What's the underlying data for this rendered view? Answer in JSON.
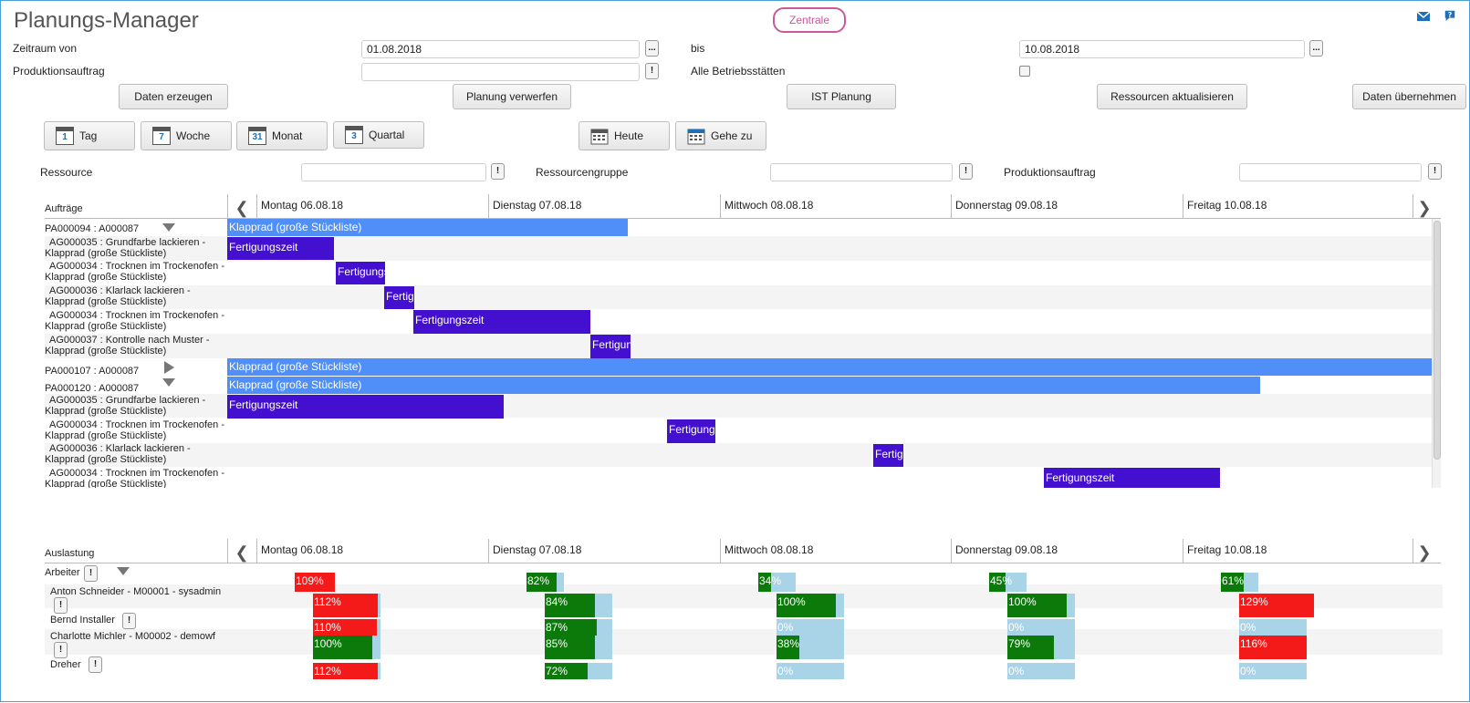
{
  "header": {
    "title": "Planungs-Manager",
    "badge": "Zentrale",
    "icons": [
      "mail-icon",
      "help-icon"
    ]
  },
  "filters": {
    "zeitraum_label": "Zeitraum von",
    "date_from": "01.08.2018",
    "bis_label": "bis",
    "date_to": "10.08.2018",
    "produktionsauftrag_label": "Produktionsauftrag",
    "produktionsauftrag_value": "",
    "alle_betriebsstaetten_label": "Alle Betriebsstätten",
    "browse_symbol": "...",
    "info_symbol": "!"
  },
  "actions": {
    "daten_erzeugen": "Daten erzeugen",
    "planung_verwerfen": "Planung verwerfen",
    "ist_planung": "IST Planung",
    "ressourcen_aktualisieren": "Ressourcen aktualisieren",
    "daten_uebernehmen": "Daten übernehmen"
  },
  "views": {
    "tag": "Tag",
    "tag_num": "1",
    "woche": "Woche",
    "woche_num": "7",
    "monat": "Monat",
    "monat_num": "31",
    "quartal": "Quartal",
    "quartal_num": "3",
    "heute": "Heute",
    "gehe_zu": "Gehe zu"
  },
  "search": {
    "ressource_label": "Ressource",
    "ressourcengruppe_label": "Ressourcengruppe",
    "produktionsauftrag_label": "Produktionsauftrag"
  },
  "gantt": {
    "header_label": "Aufträge",
    "days": [
      "Montag 06.08.18",
      "Dienstag 07.08.18",
      "Mittwoch 08.08.18",
      "Donnerstag 09.08.18",
      "Freitag 10.08.18"
    ],
    "rows": [
      {
        "label1": "PA000094 : A000087",
        "label2": "",
        "bar_text": "Klapprad (große Stückliste)"
      },
      {
        "label1": "AG000035 : Grundfarbe lackieren -",
        "label2": "Klapprad (große Stückliste)",
        "bar_text": "Fertigungszeit"
      },
      {
        "label1": "AG000034 : Trocknen im Trockenofen -",
        "label2": "Klapprad (große Stückliste)",
        "bar_text": "Fertigungszeit"
      },
      {
        "label1": "AG000036 : Klarlack lackieren -",
        "label2": "Klapprad (große Stückliste)",
        "bar_text": "Fertigungszeit"
      },
      {
        "label1": "AG000034 : Trocknen im Trockenofen -",
        "label2": "Klapprad (große Stückliste)",
        "bar_text": "Fertigungszeit"
      },
      {
        "label1": "AG000037 : Kontrolle nach Muster -",
        "label2": "Klapprad (große Stückliste)",
        "bar_text": "Fertigungszeit"
      },
      {
        "label1": "PA000107 : A000087",
        "label2": "",
        "bar_text": "Klapprad (große Stückliste)"
      },
      {
        "label1": "PA000120 : A000087",
        "label2": "",
        "bar_text": "Klapprad (große Stückliste)"
      },
      {
        "label1": "AG000035 : Grundfarbe lackieren -",
        "label2": "Klapprad (große Stückliste)",
        "bar_text": "Fertigungszeit"
      },
      {
        "label1": "AG000034 : Trocknen im Trockenofen -",
        "label2": "Klapprad (große Stückliste)",
        "bar_text": "Fertigungszeit"
      },
      {
        "label1": "AG000036 : Klarlack lackieren -",
        "label2": "Klapprad (große Stückliste)",
        "bar_text": "Fertigungszeit"
      },
      {
        "label1": "AG000034 : Trocknen im Trockenofen -",
        "label2": "Klapprad (große Stückliste)",
        "bar_text": "Fertigungszeit"
      }
    ]
  },
  "utilization": {
    "header_label": "Auslastung",
    "days": [
      "Montag 06.08.18",
      "Dienstag 07.08.18",
      "Mittwoch 08.08.18",
      "Donnerstag 09.08.18",
      "Freitag 10.08.18"
    ],
    "rows": [
      {
        "label": "Arbeiter",
        "values": [
          "109%",
          "82%",
          "34%",
          "45%",
          "61%"
        ]
      },
      {
        "label": "Anton Schneider - M00001 - sysadmin",
        "values": [
          "112%",
          "84%",
          "100%",
          "100%",
          "129%"
        ]
      },
      {
        "label": "Bernd Installer",
        "values": [
          "110%",
          "87%",
          "0%",
          "0%",
          "0%"
        ]
      },
      {
        "label": "Charlotte Michler - M00002 - demowf",
        "values": [
          "100%",
          "85%",
          "38%",
          "79%",
          "116%"
        ]
      },
      {
        "label": "Dreher",
        "values": [
          "112%",
          "72%",
          "0%",
          "0%",
          "0%"
        ]
      }
    ]
  },
  "colors": {
    "order_bar": "#4f8ff7",
    "operation_bar": "#4410d0",
    "util_ok": "#0b7a0b",
    "util_over": "#f41a1a",
    "util_capacity": "#a9d3e6",
    "badge": "#c9599a"
  }
}
